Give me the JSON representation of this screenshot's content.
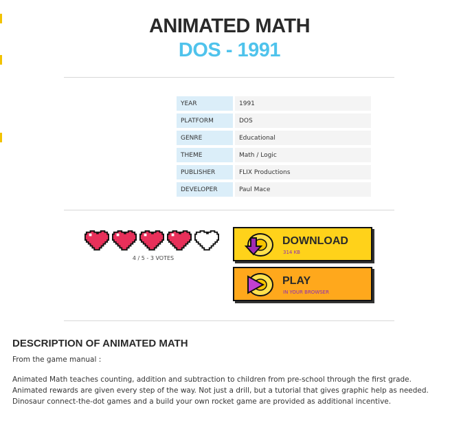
{
  "header": {
    "title": "ANIMATED MATH",
    "subtitle": "DOS - 1991"
  },
  "info": [
    {
      "key": "YEAR",
      "value": "1991"
    },
    {
      "key": "PLATFORM",
      "value": "DOS"
    },
    {
      "key": "GENRE",
      "value": "Educational"
    },
    {
      "key": "THEME",
      "value": "Math / Logic"
    },
    {
      "key": "PUBLISHER",
      "value": "FLIX Productions"
    },
    {
      "key": "DEVELOPER",
      "value": "Paul Mace"
    }
  ],
  "rating": {
    "value": 4,
    "max": 5,
    "votes_text": "4 / 5 - 3 VOTES",
    "filled_color": "#e8305a"
  },
  "download": {
    "label": "DOWNLOAD",
    "sub": "314 KB",
    "icon": "download-arrow-icon",
    "color": "#ffd21a"
  },
  "play": {
    "label": "PLAY",
    "sub": "IN YOUR BROWSER",
    "icon": "play-triangle-icon",
    "color": "#ffa81c"
  },
  "description": {
    "heading": "DESCRIPTION OF ANIMATED MATH",
    "intro": "From the game manual :",
    "body": "Animated Math teaches counting, addition and subtraction to children from pre-school through the first grade. Animated rewards are given every step of the way. Not just a drill, but a tutorial that gives graphic help as needed. Dinosaur connect-the-dot games and a build your own rocket game are provided as additional incentive."
  }
}
